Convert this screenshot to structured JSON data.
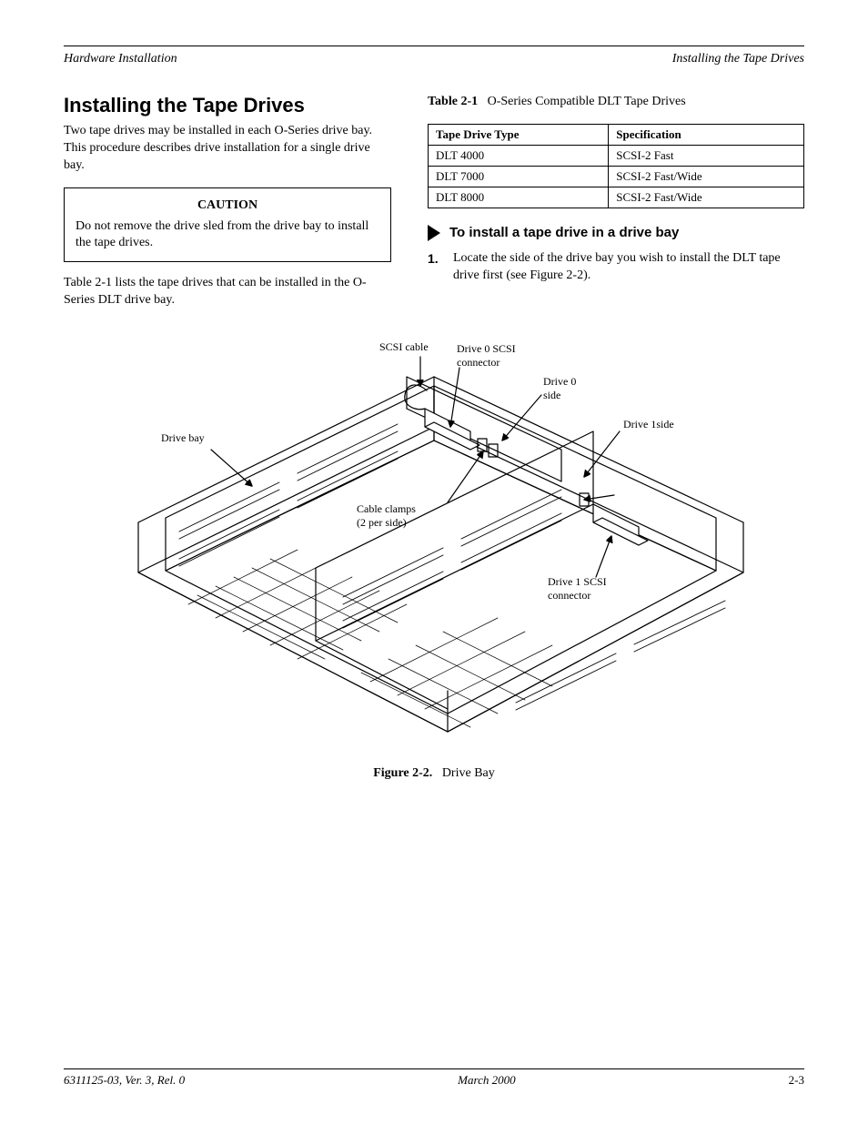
{
  "header": {
    "left": "Hardware Installation",
    "right": "Installing the Tape Drives"
  },
  "left_col": {
    "heading": "Installing the Tape Drives",
    "para1": "Two tape drives may be installed in each O-Series drive bay. This procedure describes drive installation for a single drive bay.",
    "caution": {
      "label": "CAUTION",
      "text": "Do not remove the drive sled from the drive bay to install the tape drives."
    },
    "para2": "Table 2-1 lists the tape drives that can be installed in the O-Series DLT drive bay."
  },
  "right_col": {
    "table_caption_ref": "Table 2-1",
    "table_caption_text": "O-Series Compatible DLT Tape Drives",
    "table_rows": [
      {
        "label": "Tape Drive Type",
        "value": "Specification"
      },
      {
        "label": "DLT 4000",
        "value": "SCSI-2 Fast"
      },
      {
        "label": "DLT 7000",
        "value": "SCSI-2 Fast/Wide"
      },
      {
        "label": "DLT 8000",
        "value": "SCSI-2 Fast/Wide"
      }
    ],
    "procedure_title": "To install a tape drive in a drive bay",
    "step1_num": "1.",
    "step1_text": "Locate the side of the drive bay you wish to install the DLT tape drive first (see Figure 2-2)."
  },
  "figure": {
    "callouts": {
      "driveBay": "Drive bay",
      "scsiCable": "SCSI cable",
      "drive0Conn": "Drive 0 SCSI\nconnector",
      "drive0Side": "Drive 0\nside",
      "cableClamps": "Cable clamps\n(2 per side)",
      "drive1Side": "Drive 1side",
      "drive1Conn": "Drive 1 SCSI\nconnector"
    },
    "caption_ref": "Figure 2-2.",
    "caption_text": "Drive Bay"
  },
  "footer": {
    "left": "6311125-03, Ver. 3, Rel. 0",
    "center": "March 2000",
    "right": "2-3"
  }
}
